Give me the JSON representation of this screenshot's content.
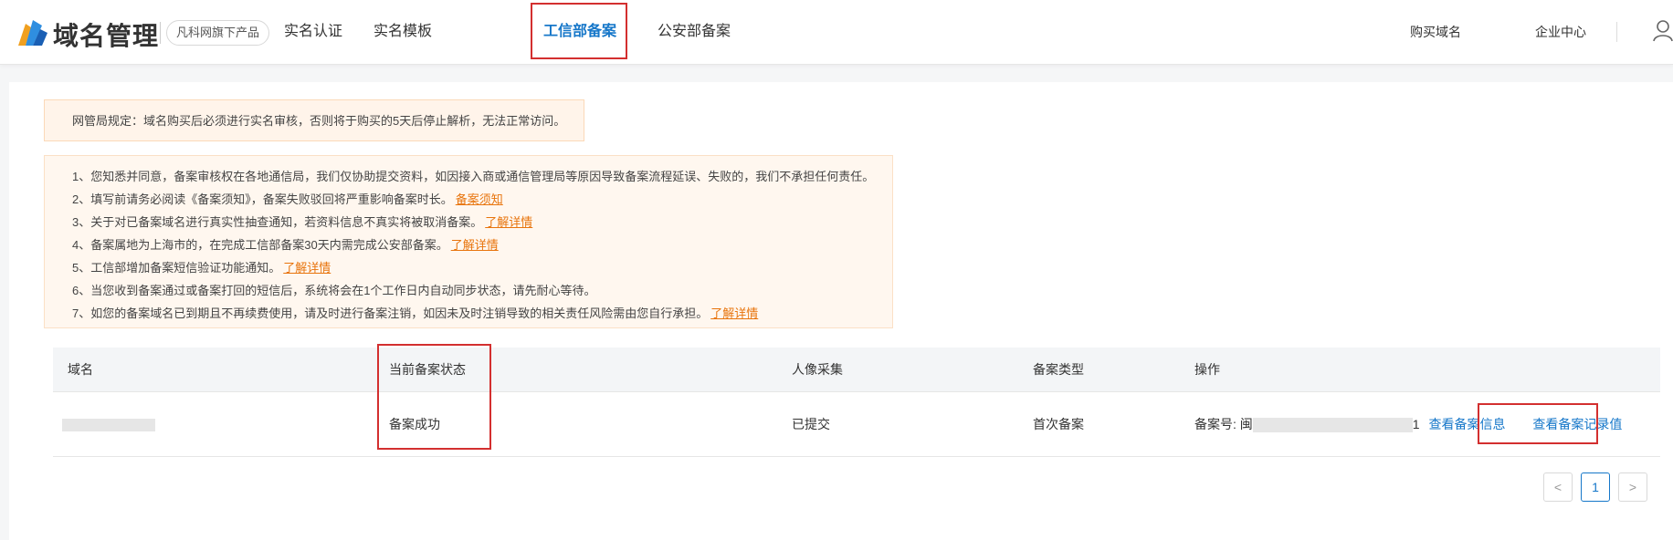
{
  "header": {
    "brand": "域名管理",
    "badge": "凡科网旗下产品",
    "nav": [
      {
        "label": "实名认证"
      },
      {
        "label": "实名模板"
      },
      {
        "label": "工信部备案"
      },
      {
        "label": "公安部备案"
      }
    ],
    "right_links": [
      {
        "label": "购买域名"
      },
      {
        "label": "企业中心"
      }
    ],
    "accent_color": "#1677c9"
  },
  "warning": "网管局规定：域名购买后必须进行实名审核，否则将于购买的5天后停止解析，无法正常访问。",
  "notices": [
    {
      "text": "1、您知悉并同意，备案审核权在各地通信局，我们仅协助提交资料，如因接入商或通信管理局等原因导致备案流程延误、失败的，我们不承担任何责任。",
      "link": ""
    },
    {
      "text": "2、填写前请务必阅读《备案须知》，备案失败驳回将严重影响备案时长。",
      "link": "备案须知"
    },
    {
      "text": "3、关于对已备案域名进行真实性抽查通知，若资料信息不真实将被取消备案。",
      "link": "了解详情"
    },
    {
      "text": "4、备案属地为上海市的，在完成工信部备案30天内需完成公安部备案。",
      "link": "了解详情"
    },
    {
      "text": "5、工信部增加备案短信验证功能通知。",
      "link": "了解详情"
    },
    {
      "text": "6、当您收到备案通过或备案打回的短信后，系统将会在1个工作日内自动同步状态，请先耐心等待。",
      "link": ""
    },
    {
      "text": "7、如您的备案域名已到期且不再续费使用，请及时进行备案注销，如因未及时注销导致的相关责任风险需由您自行承担。",
      "link": "了解详情"
    }
  ],
  "table": {
    "columns": [
      "域名",
      "当前备案状态",
      "人像采集",
      "备案类型",
      "操作"
    ],
    "rows": [
      {
        "domain": "",
        "status": "备案成功",
        "face": "已提交",
        "type": "首次备案",
        "record_prefix": "备案号: 闽",
        "record_suffix": "1",
        "view_info": "查看备案信息",
        "view_records": "查看备案记录值"
      }
    ]
  },
  "pagination": {
    "prev": "<",
    "current": "1",
    "next": ">"
  }
}
